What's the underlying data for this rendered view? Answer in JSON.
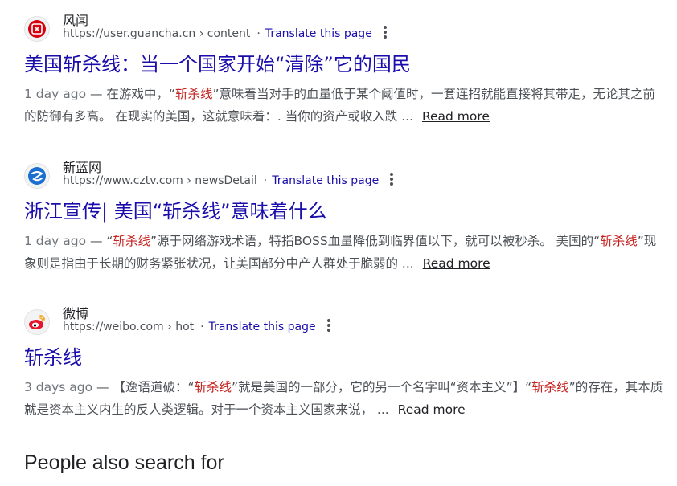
{
  "results": [
    {
      "site": "风闻",
      "url_host": "https://user.guancha.cn",
      "url_path": " › content",
      "translate": "Translate this page",
      "title": "美国斩杀线：当一个国家开始“清除”它的国民",
      "date": "1 day ago",
      "dash": " — ",
      "snippet": [
        {
          "t": "在游戏中，“"
        },
        {
          "t": "斩杀线",
          "em": true
        },
        {
          "t": "”意味着当对手的血量低于某个阈值时，一套连招就能直接将其带走，无论其之前的防御有多高。 在现实的美国，这就意味着：. 当你的资产或收入跌 ..."
        }
      ],
      "read_more": "Read more",
      "favicon": "guancha-logo-icon",
      "favicon_color": "#d7000f"
    },
    {
      "site": "新蓝网",
      "url_host": "https://www.cztv.com",
      "url_path": " › newsDetail",
      "translate": "Translate this page",
      "title": "浙江宣传| 美国“斩杀线”意味着什么",
      "date": "1 day ago",
      "dash": " — ",
      "snippet": [
        {
          "t": "“"
        },
        {
          "t": "斩杀线",
          "em": true
        },
        {
          "t": "”源于网络游戏术语，特指BOSS血量降低到临界值以下，就可以被秒杀。 美国的“"
        },
        {
          "t": "斩杀线",
          "em": true
        },
        {
          "t": "”现象则是指由于长期的财务紧张状况，让美国部分中产人群处于脆弱的 ..."
        }
      ],
      "read_more": "Read more",
      "favicon": "cztv-logo-icon",
      "favicon_color": "#1a6fd1"
    },
    {
      "site": "微博",
      "url_host": "https://weibo.com",
      "url_path": " › hot",
      "translate": "Translate this page",
      "title": "斩杀线",
      "date": "3 days ago",
      "dash": " — ",
      "snippet": [
        {
          "t": "【逸语道破：“"
        },
        {
          "t": "斩杀线",
          "em": true
        },
        {
          "t": "”就是美国的一部分，它的另一个名字叫“资本主义”】“"
        },
        {
          "t": "斩杀线",
          "em": true
        },
        {
          "t": "”的存在，其本质就是资本主义内生的反人类逻辑。对于一个资本主义国家来说， ..."
        }
      ],
      "read_more": "Read more",
      "favicon": "weibo-logo-icon",
      "favicon_color": "#e6162d"
    }
  ],
  "people_also_search": "People also search for",
  "colors": {
    "link": "#1a0dab",
    "snippet": "#4d5156",
    "highlight": "#c5221f"
  }
}
